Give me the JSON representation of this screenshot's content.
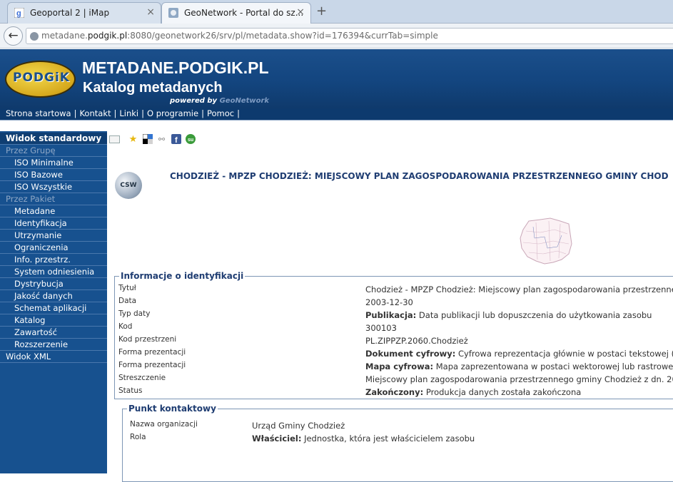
{
  "browser": {
    "tabs": [
      {
        "title": "Geoportal 2 | iMap",
        "close": "×"
      },
      {
        "title": "GeoNetwork - Portal do sz...",
        "close": "×"
      }
    ],
    "new_tab": "+",
    "back": "←",
    "url_host_pre": "metadane.",
    "url_host_bold": "podgik.pl",
    "url_rest": ":8080/geonetwork26/srv/pl/metadata.show?id=176394&currTab=simple"
  },
  "header": {
    "logo_text": "PODGiK",
    "site_name": "METADANE.PODGIK.PL",
    "site_subtitle": "Katalog metadanych",
    "powered_by": "powered by",
    "powered_brand": "GeoNetwork"
  },
  "top_menu": {
    "items": [
      "Strona startowa",
      "Kontakt",
      "Linki",
      "O programie",
      "Pomoc"
    ],
    "separator": "|"
  },
  "sidebar": {
    "items": [
      {
        "label": "Widok standardowy",
        "kind": "head"
      },
      {
        "label": "Przez Grupę",
        "kind": "group"
      },
      {
        "label": "ISO Minimalne",
        "kind": "item"
      },
      {
        "label": "ISO Bazowe",
        "kind": "item"
      },
      {
        "label": "ISO Wszystkie",
        "kind": "item"
      },
      {
        "label": "Przez Pakiet",
        "kind": "group"
      },
      {
        "label": "Metadane",
        "kind": "item"
      },
      {
        "label": "Identyfikacja",
        "kind": "item"
      },
      {
        "label": "Utrzymanie",
        "kind": "item"
      },
      {
        "label": "Ograniczenia",
        "kind": "item"
      },
      {
        "label": "Info. przestrz.",
        "kind": "item"
      },
      {
        "label": "System odniesienia",
        "kind": "item"
      },
      {
        "label": "Dystrybucja",
        "kind": "item"
      },
      {
        "label": "Jakość danych",
        "kind": "item"
      },
      {
        "label": "Schemat aplikacji",
        "kind": "item"
      },
      {
        "label": "Katalog",
        "kind": "item"
      },
      {
        "label": "Zawartość",
        "kind": "item"
      },
      {
        "label": "Rozszerzenie",
        "kind": "item"
      },
      {
        "label": "Widok XML",
        "kind": "top"
      }
    ]
  },
  "main": {
    "csw_label": "CSW",
    "title": "CHODZIEŻ - MPZP CHODZIEŻ: MIEJSCOWY PLAN ZAGOSPODAROWANIA PRZESTRZENNEGO GMINY CHOD",
    "identification": {
      "legend": "Informacje o identyfikacji",
      "rows": [
        {
          "label": "Tytuł",
          "bold": "",
          "value": "Chodzież - MPZP Chodzież: Miejscowy plan zagospodarowania przestrzenne"
        },
        {
          "label": "Data",
          "bold": "",
          "value": "2003-12-30"
        },
        {
          "label": "Typ daty",
          "bold": "Publikacja:",
          "value": " Data publikacji lub dopuszczenia do użytkowania zasobu"
        },
        {
          "label": "Kod",
          "bold": "",
          "value": "300103"
        },
        {
          "label": "Kod przestrzeni",
          "bold": "",
          "value": "PL.ZIPPZP.2060.Chodzież"
        },
        {
          "label": "Forma prezentacji",
          "bold": "Dokument cyfrowy:",
          "value": " Cyfrowa reprezentacja głównie w postaci tekstowej ("
        },
        {
          "label": "Forma prezentacji",
          "bold": "Mapa cyfrowa:",
          "value": " Mapa zaprezentowana w postaci wektorowej lub rastrowej"
        },
        {
          "label": "Streszczenie",
          "bold": "",
          "value": "Miejscowy plan zagospodarowania przestrzennego gminy Chodzież z dn. 20"
        },
        {
          "label": "Status",
          "bold": "Zakończony:",
          "value": " Produkcja danych została zakończona"
        }
      ]
    },
    "contact": {
      "legend": "Punkt kontaktowy",
      "rows": [
        {
          "label": "Nazwa organizacji",
          "bold": "",
          "value": "Urząd Gminy Chodzież"
        },
        {
          "label": "Rola",
          "bold": "Właściciel:",
          "value": " Jednostka, która jest właścicielem zasobu"
        }
      ]
    }
  }
}
